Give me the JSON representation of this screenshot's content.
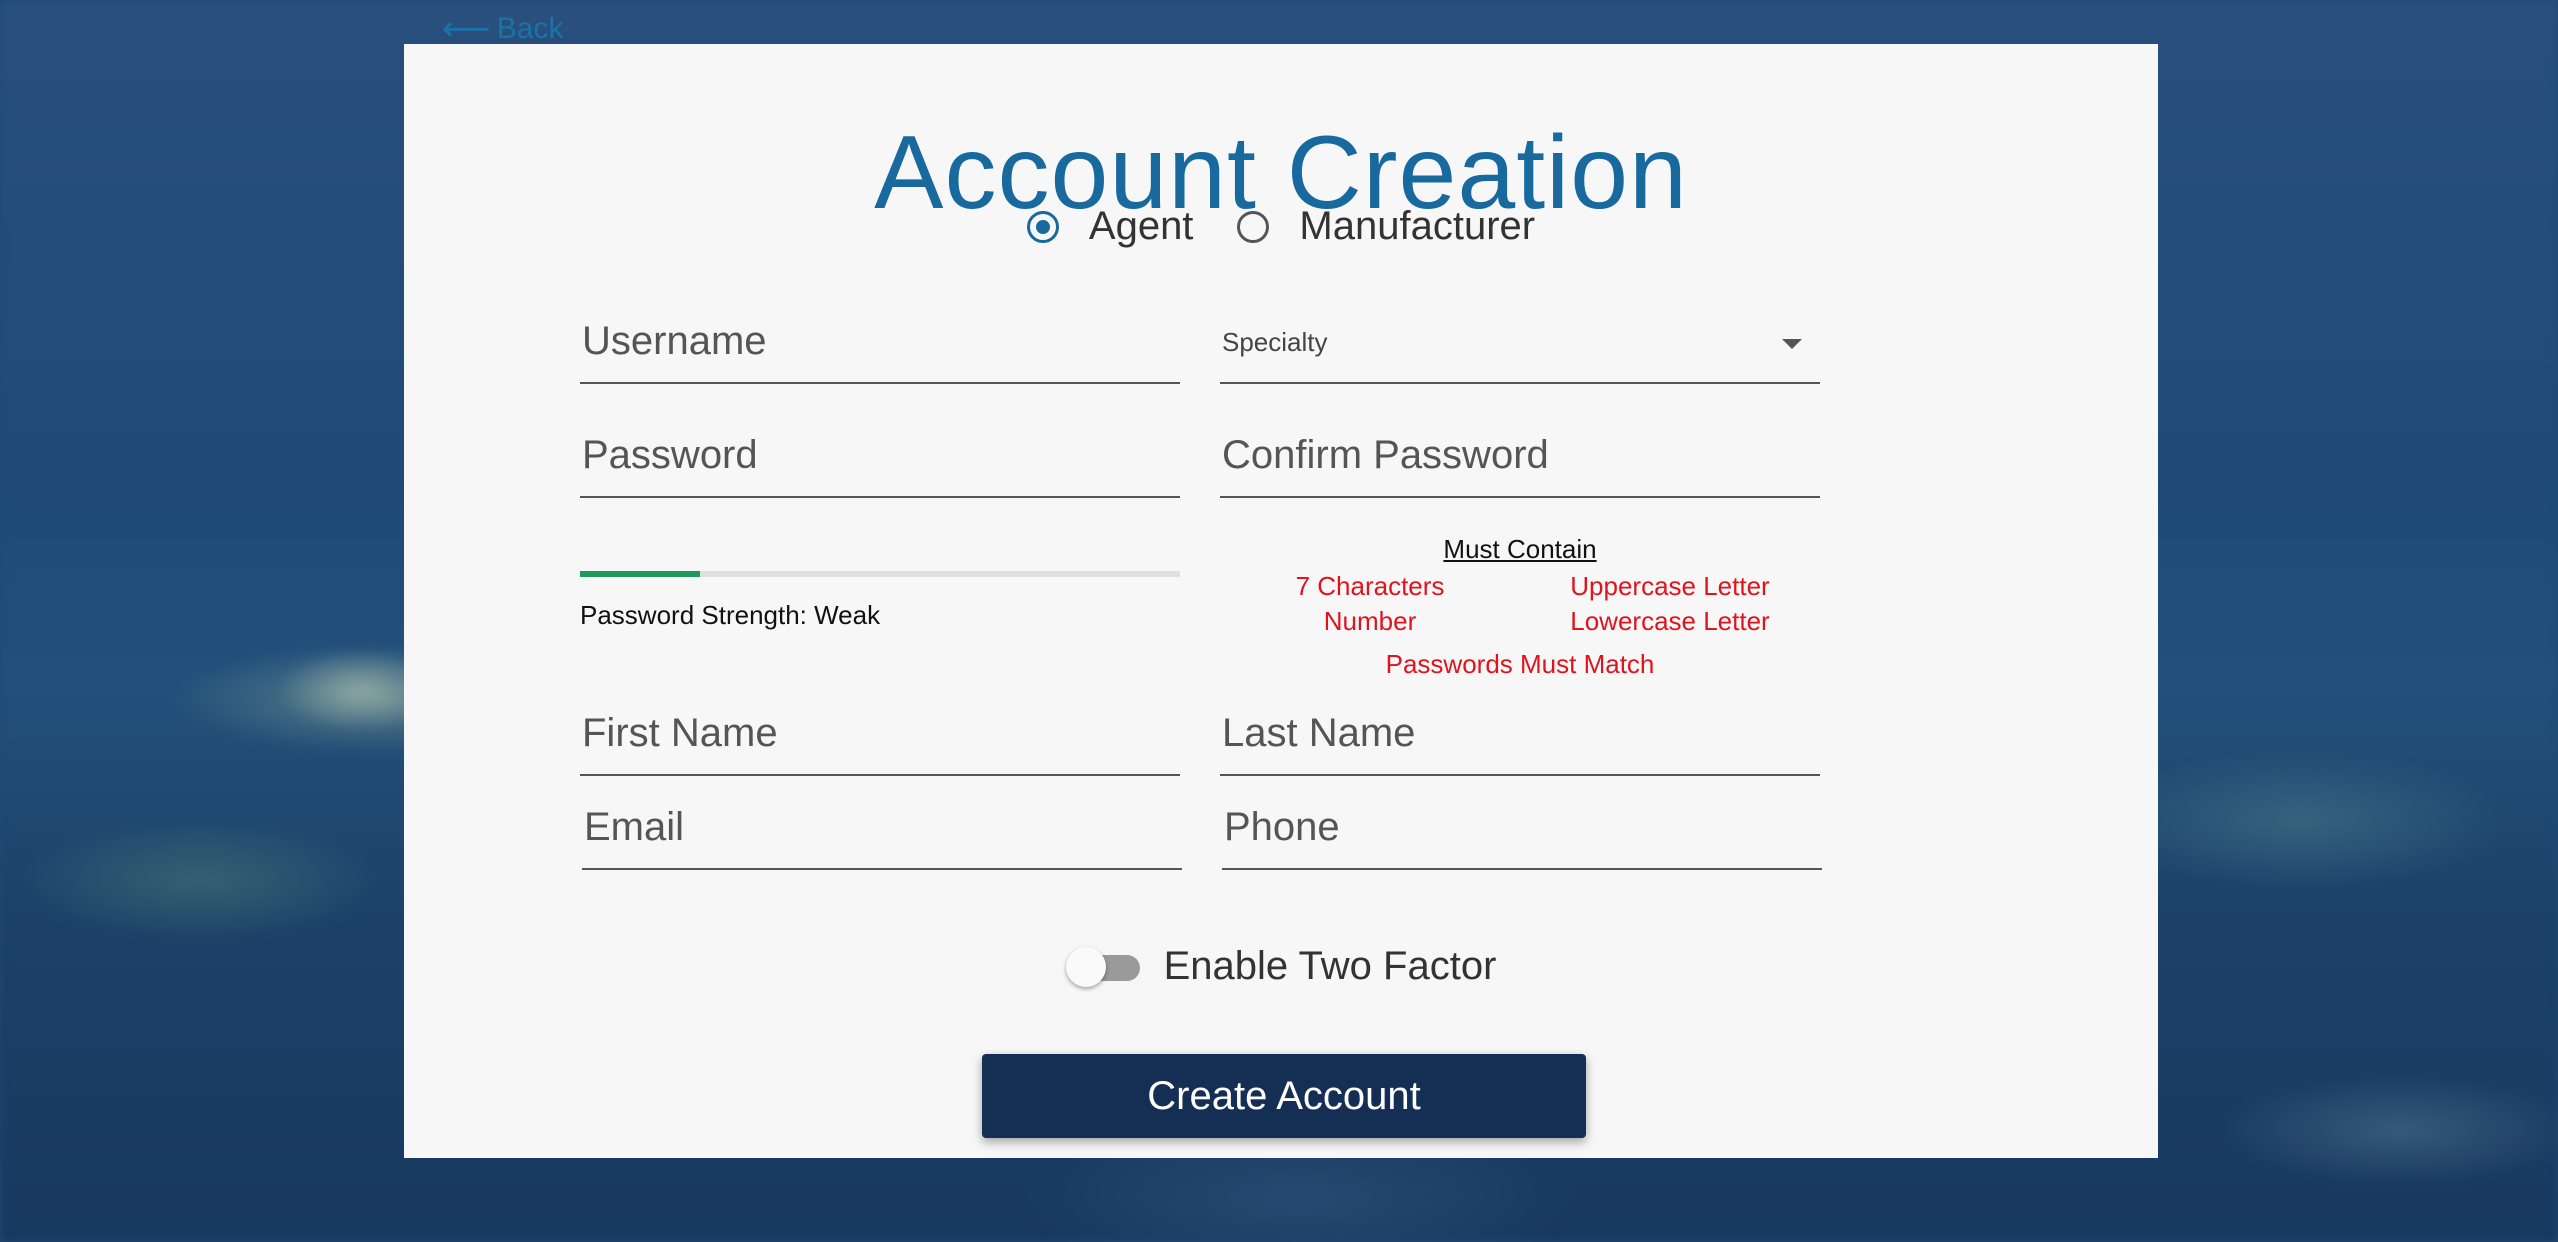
{
  "back_link": {
    "label": "Back"
  },
  "form": {
    "title": "Account Creation",
    "account_type": {
      "options": [
        {
          "label": "Agent",
          "checked": true
        },
        {
          "label": "Manufacturer",
          "checked": false
        }
      ]
    },
    "fields": {
      "username": "Username",
      "specialty": "Specialty",
      "password": "Password",
      "confirm_password": "Confirm Password",
      "first_name": "First Name",
      "last_name": "Last Name",
      "email": "Email",
      "phone": "Phone"
    },
    "password_strength": {
      "text": "Password Strength: Weak",
      "level": 0.2
    },
    "requirements": {
      "title": "Must Contain",
      "items": [
        "7 Characters",
        "Uppercase Letter",
        "Number",
        "Lowercase Letter"
      ],
      "match": "Passwords Must Match"
    },
    "two_factor": {
      "label": "Enable Two Factor",
      "enabled": false
    },
    "submit_label": "Create Account"
  },
  "colors": {
    "accent": "#17699e",
    "error": "#e0141e",
    "strength": "#1e9a5c",
    "button": "#142e54"
  }
}
